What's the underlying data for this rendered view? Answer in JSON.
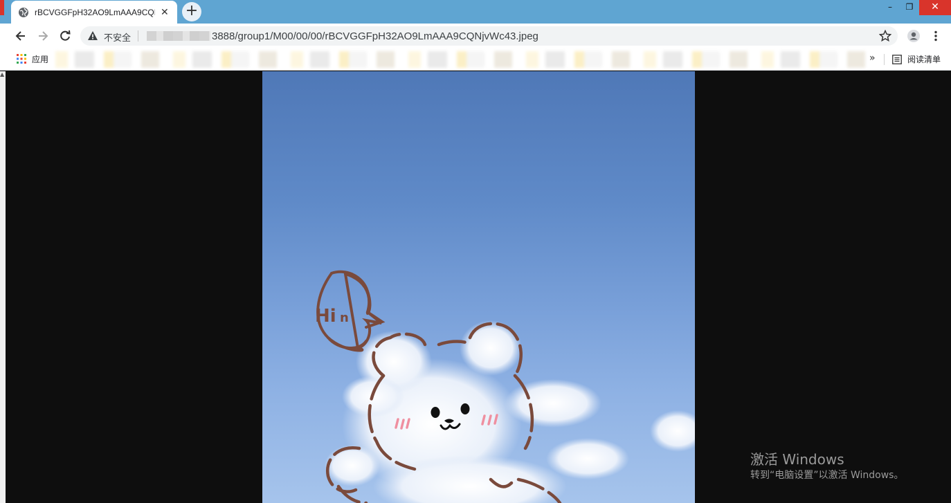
{
  "tab": {
    "title": "rBCVGGFpH32AO9LmAAA9CQNjvWc43.jpeg",
    "close_label": "✕",
    "new_tab_label": "+"
  },
  "window_controls": {
    "minimize": "–",
    "restore": "❐",
    "close": "✕"
  },
  "address_bar": {
    "security_label": "不安全",
    "url_visible": "3888/group1/M00/00/00/rBCVGGFpH32AO9LmAAA9CQNjvWc43.jpeg"
  },
  "bookmarks": {
    "apps_label": "应用",
    "overflow_label": "»",
    "reading_list_label": "阅读清单"
  },
  "image": {
    "speech_bubble_text": "Hi"
  },
  "watermark": {
    "title": "激活 Windows",
    "subtitle": "转到“电脑设置”以激活 Windows。"
  },
  "colors": {
    "tabstrip": "#5fa5d2",
    "close_red": "#d9342b",
    "sky": "#5f8ac8",
    "doodle": "#7a4a3c"
  }
}
